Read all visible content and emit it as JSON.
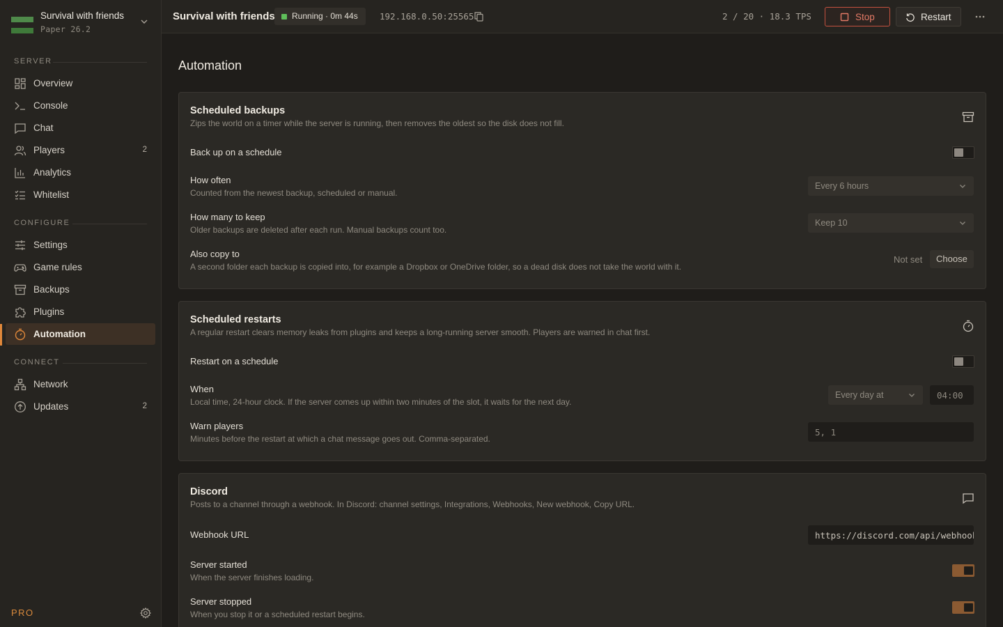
{
  "server": {
    "name": "Survival with friends",
    "version": "Paper 26.2"
  },
  "sidebar": {
    "sections": [
      {
        "label": "SERVER"
      },
      {
        "label": "CONFIGURE"
      },
      {
        "label": "CONNECT"
      }
    ],
    "items": [
      {
        "label": "Overview",
        "icon": "grid-icon"
      },
      {
        "label": "Console",
        "icon": "terminal-icon"
      },
      {
        "label": "Chat",
        "icon": "chat-icon"
      },
      {
        "label": "Players",
        "icon": "users-icon",
        "count": "2"
      },
      {
        "label": "Analytics",
        "icon": "bar-chart-icon"
      },
      {
        "label": "Whitelist",
        "icon": "checklist-icon"
      },
      {
        "label": "Settings",
        "icon": "sliders-icon"
      },
      {
        "label": "Game rules",
        "icon": "gamepad-icon"
      },
      {
        "label": "Backups",
        "icon": "archive-icon"
      },
      {
        "label": "Plugins",
        "icon": "puzzle-icon"
      },
      {
        "label": "Automation",
        "icon": "timer-icon",
        "active": true
      },
      {
        "label": "Network",
        "icon": "network-icon"
      },
      {
        "label": "Updates",
        "icon": "upload-circle-icon",
        "count": "2"
      }
    ],
    "footer_badge": "PRO"
  },
  "topbar": {
    "title": "Survival with friends",
    "status": "Running · 0m 44s",
    "address": "192.168.0.50:25565",
    "stats": "2 / 20 · 18.3 TPS",
    "stop_label": "Stop",
    "restart_label": "Restart"
  },
  "page": {
    "title": "Automation"
  },
  "backups": {
    "title": "Scheduled backups",
    "description": "Zips the world on a timer while the server is running, then removes the oldest so the disk does not fill.",
    "schedule_label": "Back up on a schedule",
    "schedule_on": false,
    "how_often_label": "How often",
    "how_often_help": "Counted from the newest backup, scheduled or manual.",
    "how_often_value": "Every 6 hours",
    "keep_label": "How many to keep",
    "keep_help": "Older backups are deleted after each run. Manual backups count too.",
    "keep_value": "Keep 10",
    "copy_label": "Also copy to",
    "copy_help": "A second folder each backup is copied into, for example a Dropbox or OneDrive folder, so a dead disk does not take the world with it.",
    "copy_value": "Not set",
    "choose_label": "Choose"
  },
  "restarts": {
    "title": "Scheduled restarts",
    "description": "A regular restart clears memory leaks from plugins and keeps a long-running server smooth. Players are warned in chat first.",
    "schedule_label": "Restart on a schedule",
    "schedule_on": false,
    "when_label": "When",
    "when_help": "Local time, 24-hour clock. If the server comes up within two minutes of the slot, it waits for the next day.",
    "when_value": "Every day at",
    "time_value": "04:00",
    "warn_label": "Warn players",
    "warn_help": "Minutes before the restart at which a chat message goes out. Comma-separated.",
    "warn_value": "5, 1"
  },
  "discord": {
    "title": "Discord",
    "description": "Posts to a channel through a webhook. In Discord: channel settings, Integrations, Webhooks, New webhook, Copy URL.",
    "webhook_label": "Webhook URL",
    "webhook_value": "https://discord.com/api/webhooks/",
    "started_label": "Server started",
    "started_help": "When the server finishes loading.",
    "started_on": true,
    "stopped_label": "Server stopped",
    "stopped_help": "When you stop it or a scheduled restart begins.",
    "stopped_on": true
  },
  "colors": {
    "accent": "#e0883a",
    "running": "#5fbf5a",
    "stop": "#c5513f",
    "toggle_on": "#8b5a32"
  }
}
